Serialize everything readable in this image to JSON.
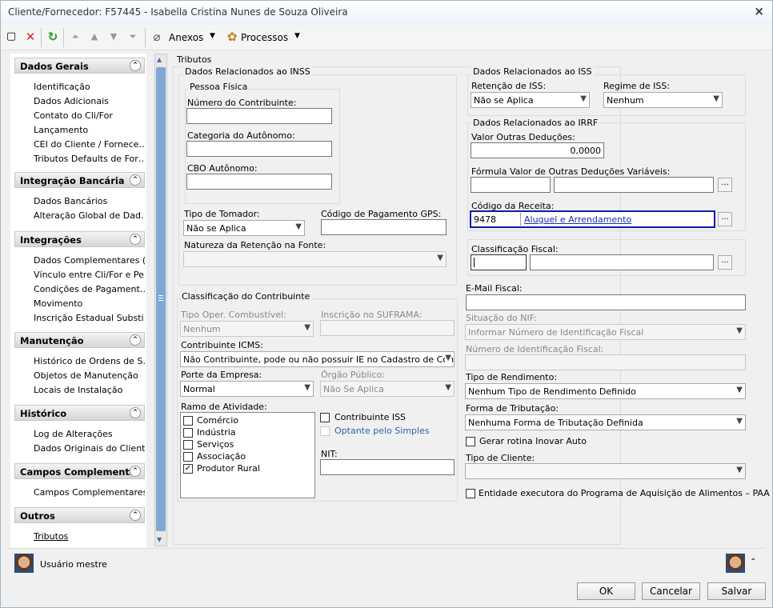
{
  "window": {
    "title": "Cliente/Fornecedor: F57445 - Isabella Cristina Nunes de Souza Oliveira",
    "close": "×"
  },
  "toolbar": {
    "anexos": "Anexos",
    "processos": "Processos"
  },
  "sidebar": [
    {
      "title": "Dados Gerais",
      "items": [
        "Identificação",
        "Dados Adicionais",
        "Contato do Cli/For",
        "Lançamento",
        "CEI do Cliente / Fornece…",
        "Tributos Defaults de For…"
      ]
    },
    {
      "title": "Integração Bancária",
      "items": [
        "Dados Bancários",
        "Alteração Global de Dad…"
      ]
    },
    {
      "title": "Integrações",
      "items": [
        "Dados Complementares (…",
        "Vínculo entre Cli/For e Pe…",
        "Condições de Pagament…",
        "Movimento",
        "Inscrição Estadual Substi…"
      ]
    },
    {
      "title": "Manutenção",
      "items": [
        "Histórico de Ordens de S…",
        "Objetos de Manutenção",
        "Locais de Instalação"
      ]
    },
    {
      "title": "Histórico",
      "items": [
        "Log de Alterações",
        "Dados Originais do Client…"
      ]
    },
    {
      "title": "Campos Complementar",
      "items": [
        "Campos Complementares"
      ]
    },
    {
      "title": "Outros",
      "items": [
        "Tributos"
      ]
    }
  ],
  "main": {
    "tributos": "Tributos",
    "inss": {
      "title": "Dados Relacionados ao INSS",
      "pf": "Pessoa Física",
      "num_contrib": "Número do Contribuinte:",
      "cat_aut": "Categoria do Autônomo:",
      "cbo": "CBO Autônomo:",
      "tipo_tomador": "Tipo de Tomador:",
      "tipo_tomador_val": "Não se Aplica",
      "gps": "Código de Pagamento GPS:",
      "natureza": "Natureza da Retenção na Fonte:"
    },
    "iss": {
      "title": "Dados Relacionados ao ISS",
      "retencao": "Retenção de ISS:",
      "retencao_val": "Não se Aplica",
      "regime": "Regime de ISS:",
      "regime_val": "Nenhum"
    },
    "irrf": {
      "title": "Dados Relacionados ao IRRF",
      "valor_outras": "Valor Outras Deduções:",
      "valor_outras_val": "0,0000",
      "formula": "Fórmula Valor de Outras Deduções Variáveis:",
      "cod_receita": "Código da Receita:",
      "cod_receita_val": "9478",
      "cod_receita_desc": "Aluguel e Arrendamento"
    },
    "class_fiscal": "Classificação Fiscal:",
    "contrib": {
      "title": "Classificação do Contribuinte",
      "tipo_oper": "Tipo Oper. Combustível:",
      "tipo_oper_val": "Nenhum",
      "suframa": "Inscrição no SUFRAMA:",
      "icms": "Contribuinte ICMS:",
      "icms_val": "Não Contribuinte, pode ou não possuir IE no Cadastro de Contribu",
      "porte": "Porte da Empresa:",
      "porte_val": "Normal",
      "orgao": "Órgão Público:",
      "orgao_val": "Não Se Aplica",
      "ramo": "Ramo de Atividade:",
      "ramo_items": [
        {
          "label": "Comércio",
          "checked": false
        },
        {
          "label": "Indústria",
          "checked": false
        },
        {
          "label": "Serviços",
          "checked": false
        },
        {
          "label": "Associação",
          "checked": false
        },
        {
          "label": "Produtor Rural",
          "checked": true
        }
      ],
      "contrib_iss": "Contribuinte ISS",
      "simples": "Optante pelo Simples",
      "nit": "NIT:"
    },
    "right": {
      "email": "E-Mail Fiscal:",
      "nif_sit": "Situação do NIF:",
      "nif_sit_val": "Informar Número de Identificação Fiscal",
      "nif_num": "Número de Identificação Fiscal:",
      "tipo_rend": "Tipo de Rendimento:",
      "tipo_rend_val": "Nenhum Tipo de Rendimento Definido",
      "forma_trib": "Forma de Tributação:",
      "forma_trib_val": "Nenhuma Forma de Tributação Definida",
      "inovar": "Gerar rotina Inovar Auto",
      "tipo_cliente": "Tipo de Cliente:",
      "paa": "Entidade executora do Programa de Aquisição de Alimentos – PAA"
    }
  },
  "footer": {
    "user": "Usuário mestre",
    "ok": "OK",
    "cancel": "Cancelar",
    "save": "Salvar"
  }
}
